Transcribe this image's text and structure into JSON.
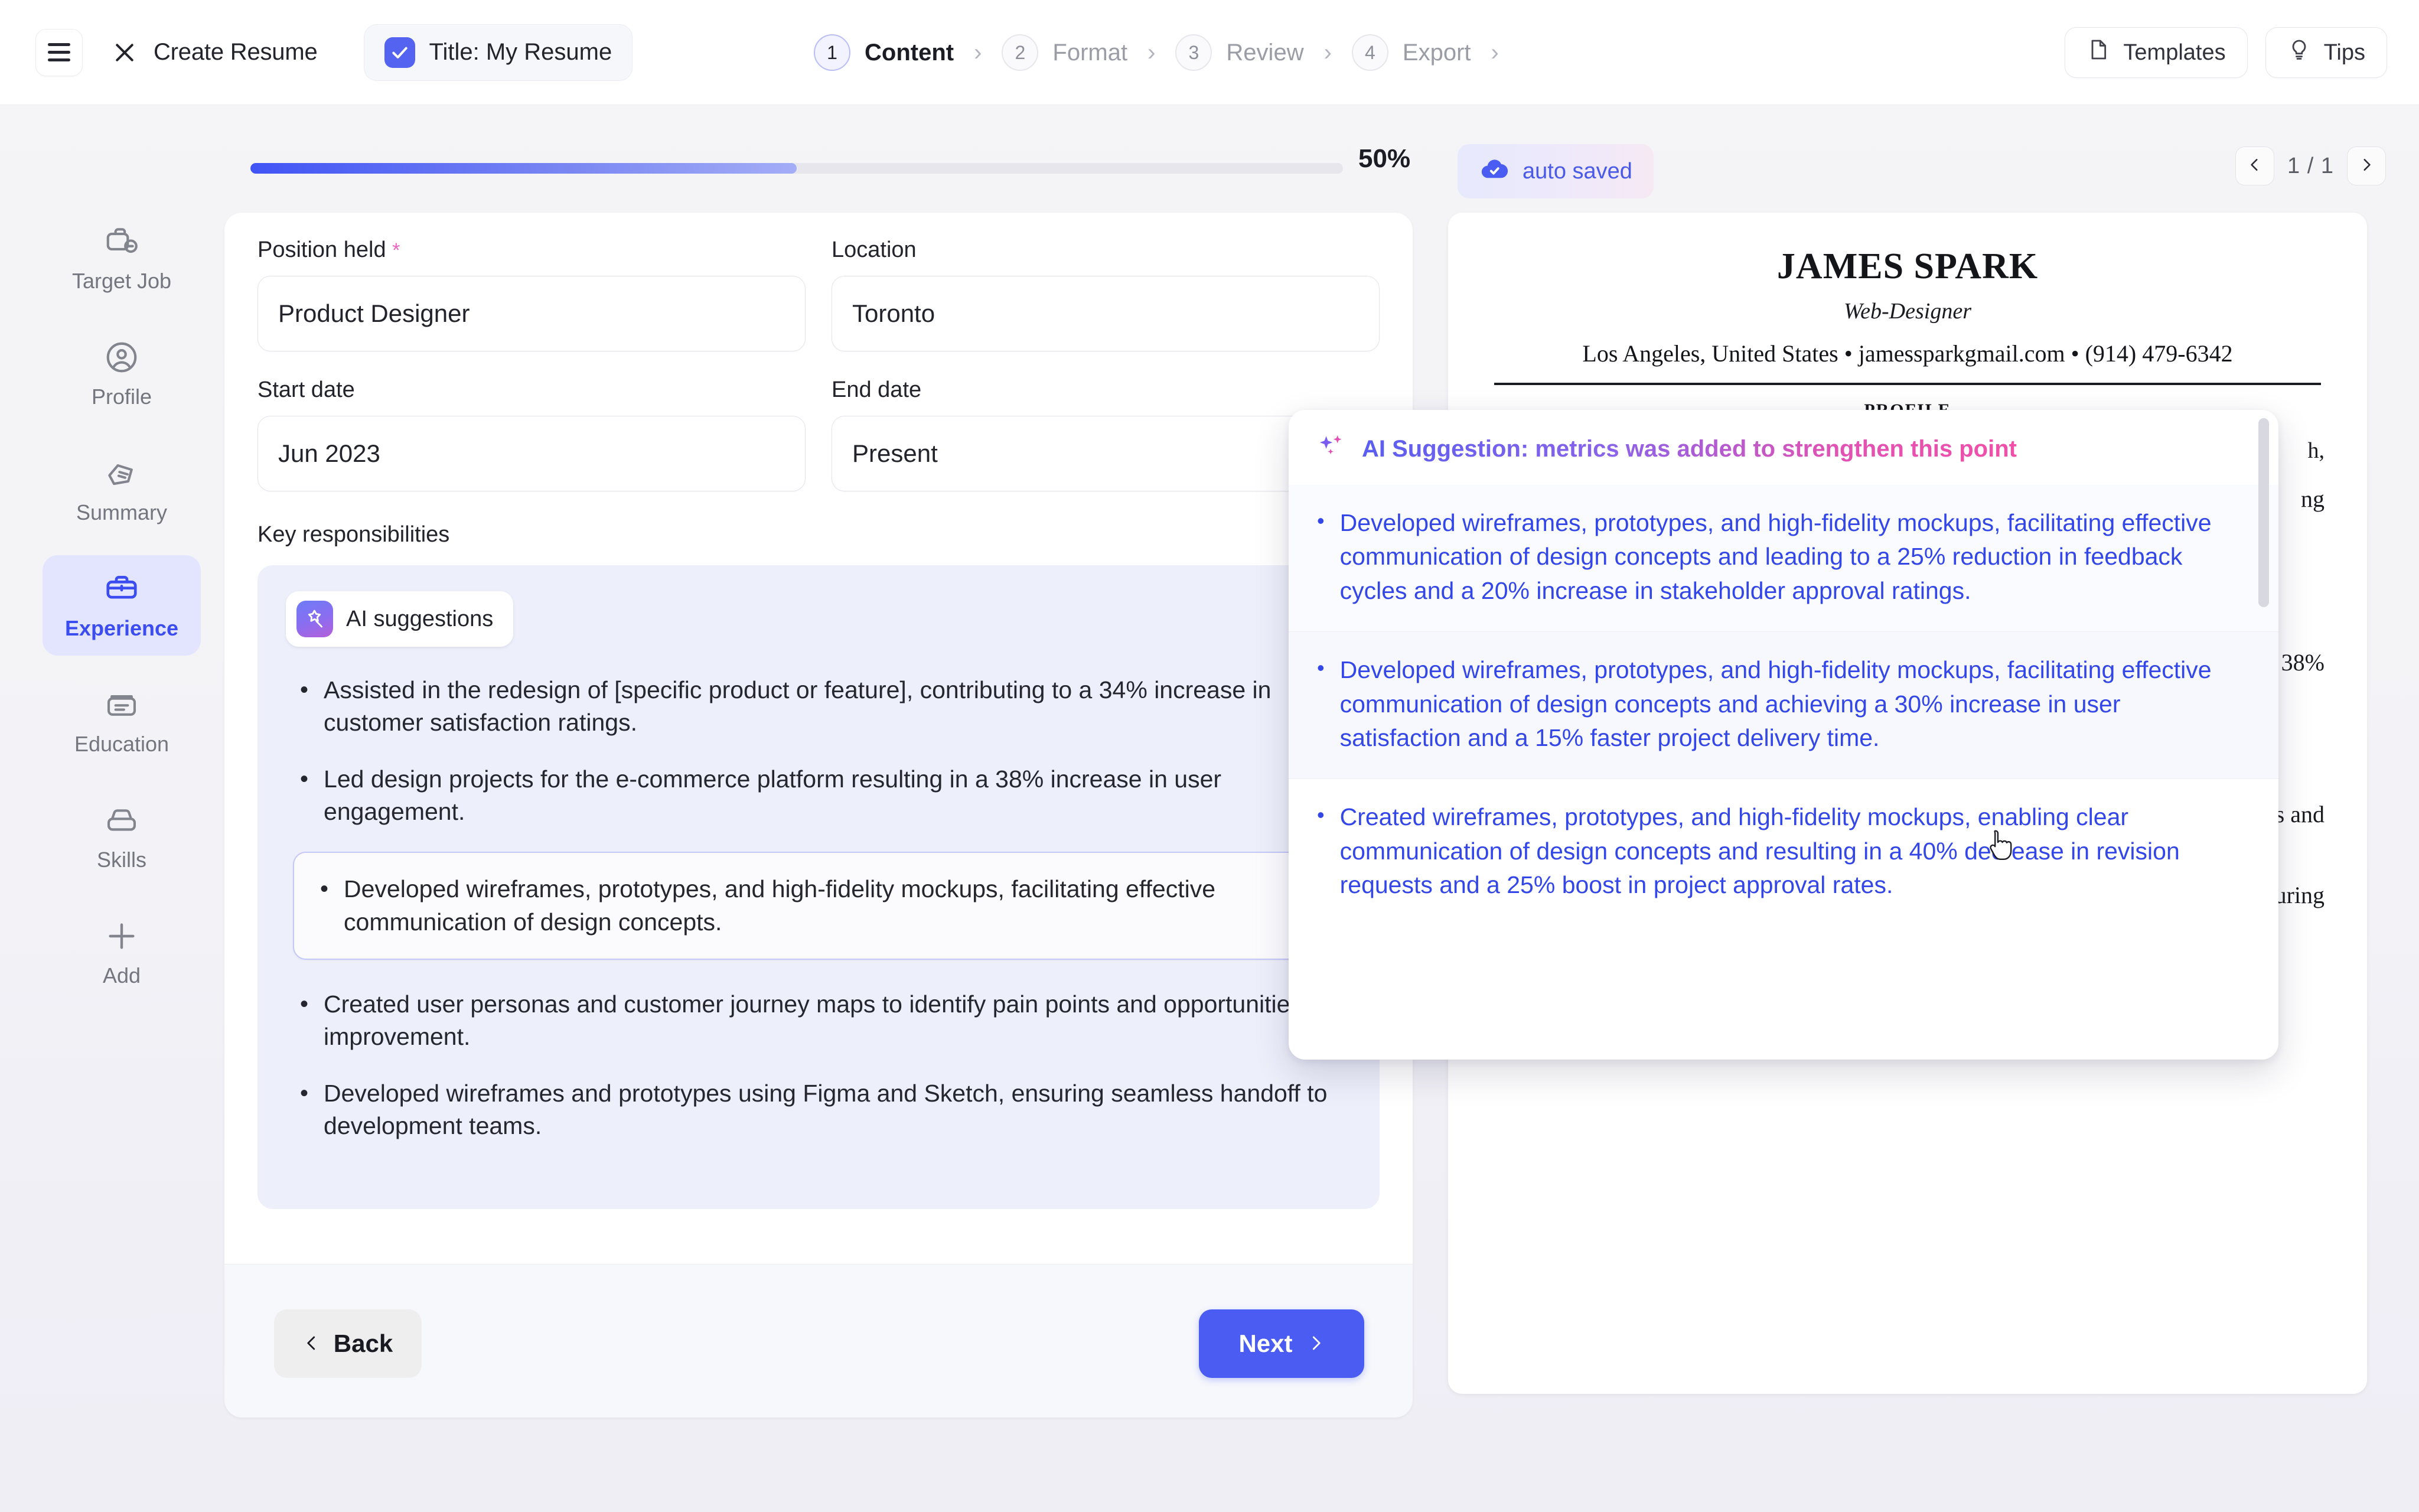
{
  "topbar": {
    "menu_icon": "hamburger-icon",
    "close_icon": "close-icon",
    "app_title": "Create Resume",
    "title_chip": {
      "checkbox_icon": "check-icon",
      "label": "Title: My Resume"
    },
    "steps": [
      {
        "num": "1",
        "label": "Content",
        "active": true
      },
      {
        "num": "2",
        "label": "Format",
        "active": false
      },
      {
        "num": "3",
        "label": "Review",
        "active": false
      },
      {
        "num": "4",
        "label": "Export",
        "active": false
      }
    ],
    "chevron": "›",
    "templates_button": {
      "label": "Templates",
      "icon": "document-icon"
    },
    "tips_button": {
      "label": "Tips",
      "icon": "lightbulb-icon"
    }
  },
  "progress": {
    "percent_label": "50%",
    "percent_value": 50,
    "autosaved_label": "auto saved",
    "autosaved_icon": "cloud-check-icon",
    "pager": {
      "prev_icon": "chevron-left-icon",
      "next_icon": "chevron-right-icon",
      "page_label": "1 / 1"
    }
  },
  "sidebar": {
    "items": [
      {
        "label": "Target Job",
        "icon": "briefcase-link-icon",
        "active": false
      },
      {
        "label": "Profile",
        "icon": "user-circle-icon",
        "active": false
      },
      {
        "label": "Summary",
        "icon": "note-pages-icon",
        "active": false
      },
      {
        "label": "Experience",
        "icon": "briefcase-icon",
        "active": true
      },
      {
        "label": "Education",
        "icon": "archive-box-icon",
        "active": false
      },
      {
        "label": "Skills",
        "icon": "tray-icon",
        "active": false
      },
      {
        "label": "Add",
        "icon": "plus-icon",
        "active": false
      }
    ]
  },
  "form": {
    "position_held": {
      "label": "Position held",
      "required_mark": "*",
      "value": "Product Designer"
    },
    "location": {
      "label": "Location",
      "value": "Toronto"
    },
    "start_date": {
      "label": "Start date",
      "value": "Jun 2023"
    },
    "end_date": {
      "label": "End date",
      "value": "Present"
    },
    "key_responsibilities_label": "Key responsibilities",
    "ai_suggestions_chip": {
      "label": "AI suggestions",
      "icon": "magic-wand-star-icon"
    },
    "bullets": [
      {
        "text": "Assisted in the redesign of [specific product or feature], contributing to a 34% increase in customer satisfaction ratings.",
        "highlighted": false
      },
      {
        "text": "Led design projects for the e-commerce platform resulting in a 38% increase in user engagement.",
        "highlighted": false
      },
      {
        "text": "Developed wireframes, prototypes, and high-fidelity mockups, facilitating effective communication of design concepts.",
        "highlighted": true
      },
      {
        "text": "Created user personas and customer journey maps to identify pain points and opportunities for improvement.",
        "highlighted": false
      },
      {
        "text": "Developed wireframes and prototypes using Figma and Sketch, ensuring seamless handoff to development teams.",
        "highlighted": false
      }
    ],
    "back_button": {
      "label": "Back",
      "icon": "chevron-left-icon"
    },
    "next_button": {
      "label": "Next",
      "icon": "chevron-right-icon"
    }
  },
  "ai_popup": {
    "sparkle_icon": "sparkles-icon",
    "heading": "AI Suggestion: metrics was added to strengthen this point",
    "suggestions": [
      {
        "text": "Developed wireframes, prototypes, and high-fidelity mockups, facilitating effective communication of design concepts and leading to a 25% reduction in feedback cycles and a 20% increase in stakeholder approval ratings.",
        "hovered": false
      },
      {
        "text": "Developed wireframes, prototypes, and high-fidelity mockups, facilitating effective communication of design concepts and achieving a 30% increase in user satisfaction and a 15% faster project delivery time.",
        "hovered": true
      },
      {
        "text": "Created wireframes, prototypes, and high-fidelity mockups, enabling clear communication of design concepts and resulting in a 40% decrease in revision requests and a 25% boost in project approval rates.",
        "hovered": false
      }
    ]
  },
  "preview": {
    "name": "JAMES SPARK",
    "role": "Web-Designer",
    "contact": "Los Angeles, United States • jamessparkgmail.com • (914) 479-6342",
    "section_title": "PROFILE",
    "visible_fragments": [
      "h,",
      "ng",
      "38%",
      "s and",
      "uring"
    ]
  },
  "colors": {
    "accent": "#4a5cf2",
    "accent_light": "#e3e5ff",
    "suggestion_text": "#3347e8",
    "required": "#e866c0",
    "gradient_start": "#5a5ef0",
    "gradient_end": "#f14fa8"
  }
}
